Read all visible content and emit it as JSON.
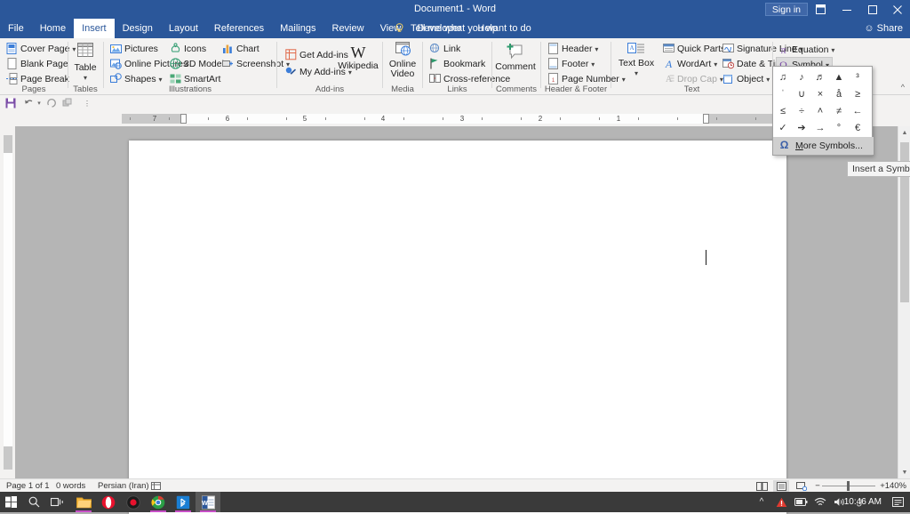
{
  "titlebar": {
    "document_title": "Document1  -  Word",
    "signin_label": "Sign in",
    "ribbon_display_icon": "ribbon-display-options-icon",
    "minimize_icon": "minimize-icon",
    "maximize_icon": "maximize-icon",
    "close_icon": "close-icon"
  },
  "tabs": [
    {
      "label": "File",
      "active": false
    },
    {
      "label": "Home",
      "active": false
    },
    {
      "label": "Insert",
      "active": true
    },
    {
      "label": "Design",
      "active": false
    },
    {
      "label": "Layout",
      "active": false
    },
    {
      "label": "References",
      "active": false
    },
    {
      "label": "Mailings",
      "active": false
    },
    {
      "label": "Review",
      "active": false
    },
    {
      "label": "View",
      "active": false
    },
    {
      "label": "Developer",
      "active": false
    },
    {
      "label": "Help",
      "active": false
    }
  ],
  "tellme": {
    "placeholder": "Tell me what you want to do",
    "icon": "lightbulb-icon"
  },
  "share": {
    "label": "Share",
    "icon": "share-person-icon"
  },
  "qat": {
    "save": "save-icon",
    "undo": "undo-icon",
    "redo": "redo-icon",
    "repeat": "repeat-icon",
    "customize": "customize-quick-access-toolbar-icon"
  },
  "ribbon": {
    "groups": [
      {
        "name": "Pages",
        "label": "Pages",
        "items": [
          {
            "label": "Cover Page",
            "dropdown": true
          },
          {
            "label": "Blank Page",
            "dropdown": false
          },
          {
            "label": "Page Break",
            "dropdown": false
          }
        ]
      },
      {
        "name": "Tables",
        "label": "Tables",
        "items": [
          {
            "label": "Table",
            "dropdown": true
          }
        ]
      },
      {
        "name": "Illustrations",
        "label": "Illustrations",
        "items": [
          {
            "label": "Pictures",
            "dropdown": false
          },
          {
            "label": "Online Pictures",
            "dropdown": false
          },
          {
            "label": "Shapes",
            "dropdown": true
          },
          {
            "label": "Icons",
            "dropdown": false
          },
          {
            "label": "3D Models",
            "dropdown": false
          },
          {
            "label": "SmartArt",
            "dropdown": false
          },
          {
            "label": "Chart",
            "dropdown": false
          },
          {
            "label": "Screenshot",
            "dropdown": true
          }
        ]
      },
      {
        "name": "Add-ins",
        "label": "Add-ins",
        "items": [
          {
            "label": "Get Add-ins",
            "dropdown": false
          },
          {
            "label": "My Add-ins",
            "dropdown": true
          },
          {
            "label": "Wikipedia",
            "dropdown": false
          }
        ]
      },
      {
        "name": "Media",
        "label": "Media",
        "items": [
          {
            "label": "Online Video",
            "dropdown": false
          }
        ]
      },
      {
        "name": "Links",
        "label": "Links",
        "items": [
          {
            "label": "Link",
            "dropdown": false
          },
          {
            "label": "Bookmark",
            "dropdown": false
          },
          {
            "label": "Cross-reference",
            "dropdown": false
          }
        ]
      },
      {
        "name": "Comments",
        "label": "Comments",
        "items": [
          {
            "label": "Comment",
            "dropdown": false
          }
        ]
      },
      {
        "name": "Header & Footer",
        "label": "Header & Footer",
        "items": [
          {
            "label": "Header",
            "dropdown": true
          },
          {
            "label": "Footer",
            "dropdown": true
          },
          {
            "label": "Page Number",
            "dropdown": true
          }
        ]
      },
      {
        "name": "Text",
        "label": "Text",
        "items": [
          {
            "label": "Text Box",
            "dropdown": true
          },
          {
            "label": "Quick Parts",
            "dropdown": true
          },
          {
            "label": "WordArt",
            "dropdown": true
          },
          {
            "label": "Drop Cap",
            "dropdown": true,
            "disabled": true
          },
          {
            "label": "Signature Line",
            "dropdown": true
          },
          {
            "label": "Date & Time",
            "dropdown": false
          },
          {
            "label": "Object",
            "dropdown": true
          }
        ]
      },
      {
        "name": "Symbols",
        "label": "",
        "items": [
          {
            "label": "Equation",
            "dropdown": true
          },
          {
            "label": "Symbol",
            "dropdown": true,
            "selected": true
          }
        ]
      }
    ],
    "collapse_icon": "collapse-ribbon-icon"
  },
  "symbol_menu": {
    "open": true,
    "symbols": [
      "♫",
      "♪",
      "♬",
      "▲",
      "³",
      "ˈ",
      "∪",
      "×",
      "å",
      "≥",
      "≤",
      "÷",
      "˄",
      "≠",
      "←",
      "✓",
      "➔",
      "→",
      "°",
      "€"
    ],
    "more_symbols": {
      "accel": "M",
      "rest": "ore Symbols...",
      "icon": "omega-symbol-icon"
    }
  },
  "tooltip": {
    "text": "Insert a Symbol"
  },
  "ruler": {
    "numbers": [
      "7",
      "6",
      "5",
      "4",
      "3",
      "2",
      "1"
    ],
    "left_indent_icon": "indent-marker",
    "right_indent_icon": "indent-marker"
  },
  "document": {
    "caret": "text-cursor"
  },
  "statusbar": {
    "page": "Page 1 of 1",
    "words": "0 words",
    "language": "Persian (Iran)",
    "proofing_icon": "proofing-errors-icon",
    "views": [
      {
        "name": "read-mode",
        "icon": "☷",
        "active": false
      },
      {
        "name": "print-layout",
        "icon": "☰",
        "active": true
      },
      {
        "name": "web-layout",
        "icon": "⌸",
        "active": false
      }
    ],
    "zoom_out": "−",
    "zoom_in": "+",
    "zoom_level": "140%"
  },
  "taskbar": {
    "start_icon": "windows-start-icon",
    "search_icon": "search-icon",
    "taskview_icon": "task-view-icon",
    "apps": [
      {
        "name": "file-explorer",
        "color": "#ffb64d",
        "running": true
      },
      {
        "name": "opera-browser",
        "color": "#e8112d",
        "running": false
      },
      {
        "name": "screen-recorder",
        "color": "#1c1c1c",
        "running": false
      },
      {
        "name": "google-chrome",
        "color": "#2a9d45",
        "running": true
      },
      {
        "name": "bluetooth-app",
        "color": "#1a7fd4",
        "running": true
      },
      {
        "name": "microsoft-word",
        "color": "#2b579a",
        "running": true,
        "active": true
      }
    ],
    "tray": [
      {
        "name": "show-hidden-icons",
        "glyph": "∧"
      },
      {
        "name": "warning-icon",
        "glyph": "⚠"
      },
      {
        "name": "battery-icon",
        "glyph": "▭"
      },
      {
        "name": "wifi-icon",
        "glyph": "◜"
      },
      {
        "name": "volume-icon",
        "glyph": "ὐA"
      },
      {
        "name": "keyboard-language-icon",
        "glyph": "Ꮪ"
      }
    ],
    "clock": "10:46 AM",
    "notifications_icon": "notification-center-icon"
  }
}
